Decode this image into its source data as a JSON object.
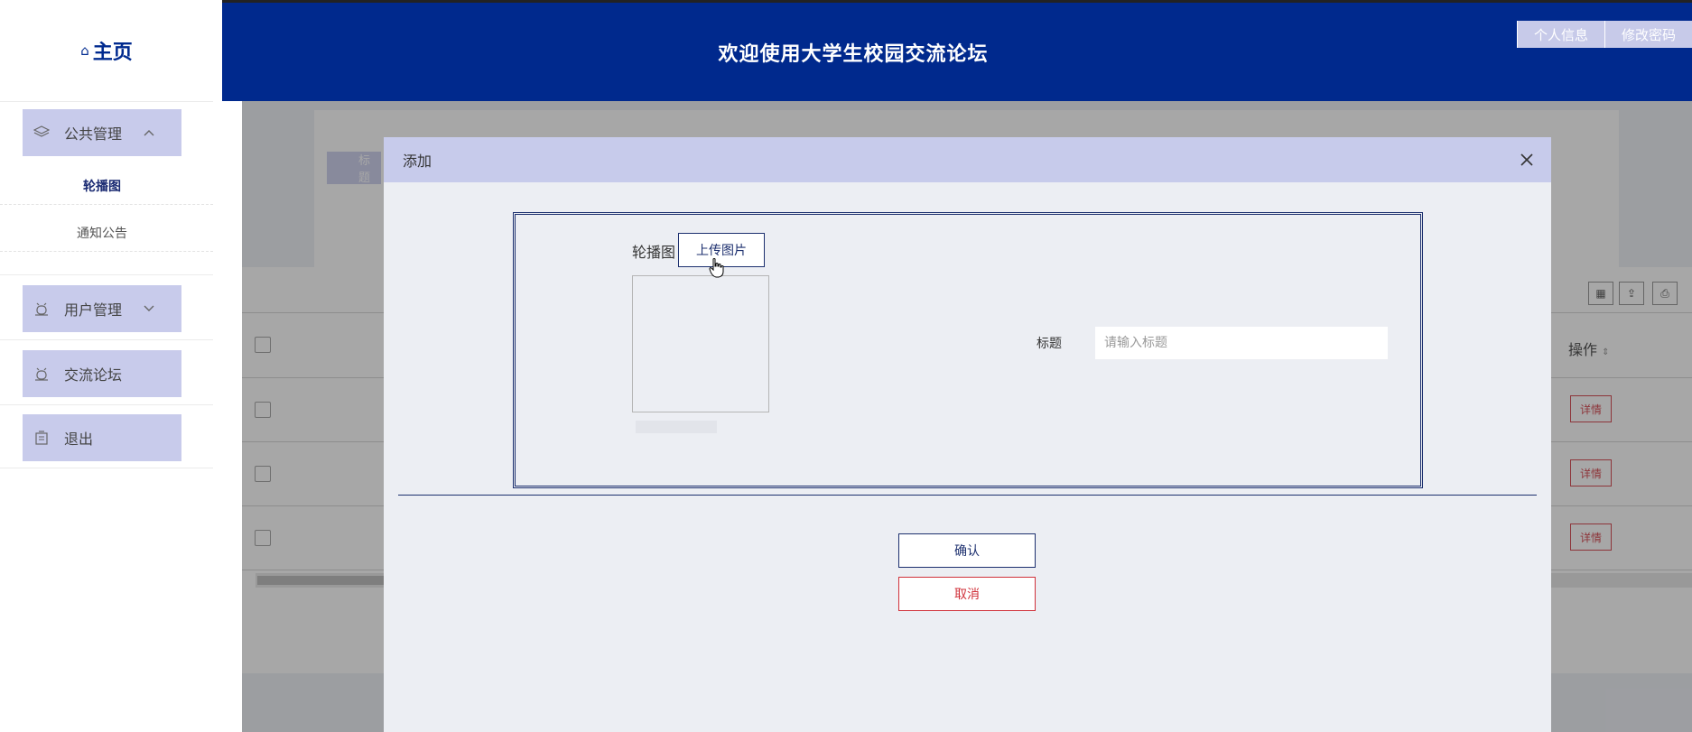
{
  "sidebar": {
    "home_label": "主页",
    "groups": [
      {
        "label": "公共管理",
        "icon": "layers-icon",
        "expanded": true
      },
      {
        "label": "用户管理",
        "icon": "alarm-icon",
        "expanded": false
      },
      {
        "label": "交流论坛",
        "icon": "alarm-icon"
      },
      {
        "label": "退出",
        "icon": "document-icon"
      }
    ],
    "subitems": [
      {
        "label": "轮播图",
        "active": true
      },
      {
        "label": "通知公告",
        "active": false
      }
    ]
  },
  "header": {
    "title": "欢迎使用大学生校园交流论坛",
    "buttons": [
      "个人信息",
      "修改密码"
    ]
  },
  "background": {
    "search_tag": "标题",
    "ops_header": "操作",
    "detail_label": "详情"
  },
  "modal": {
    "title": "添加",
    "image_label": "轮播图",
    "upload_label": "上传图片",
    "title_label": "标题",
    "title_placeholder": "请输入标题",
    "title_value": "",
    "confirm_label": "确认",
    "cancel_label": "取消"
  },
  "colors": {
    "primary": "#00298d",
    "menu_bg": "#c8cbeb",
    "danger": "#d0313a",
    "modal_head": "#c7cbeb"
  }
}
